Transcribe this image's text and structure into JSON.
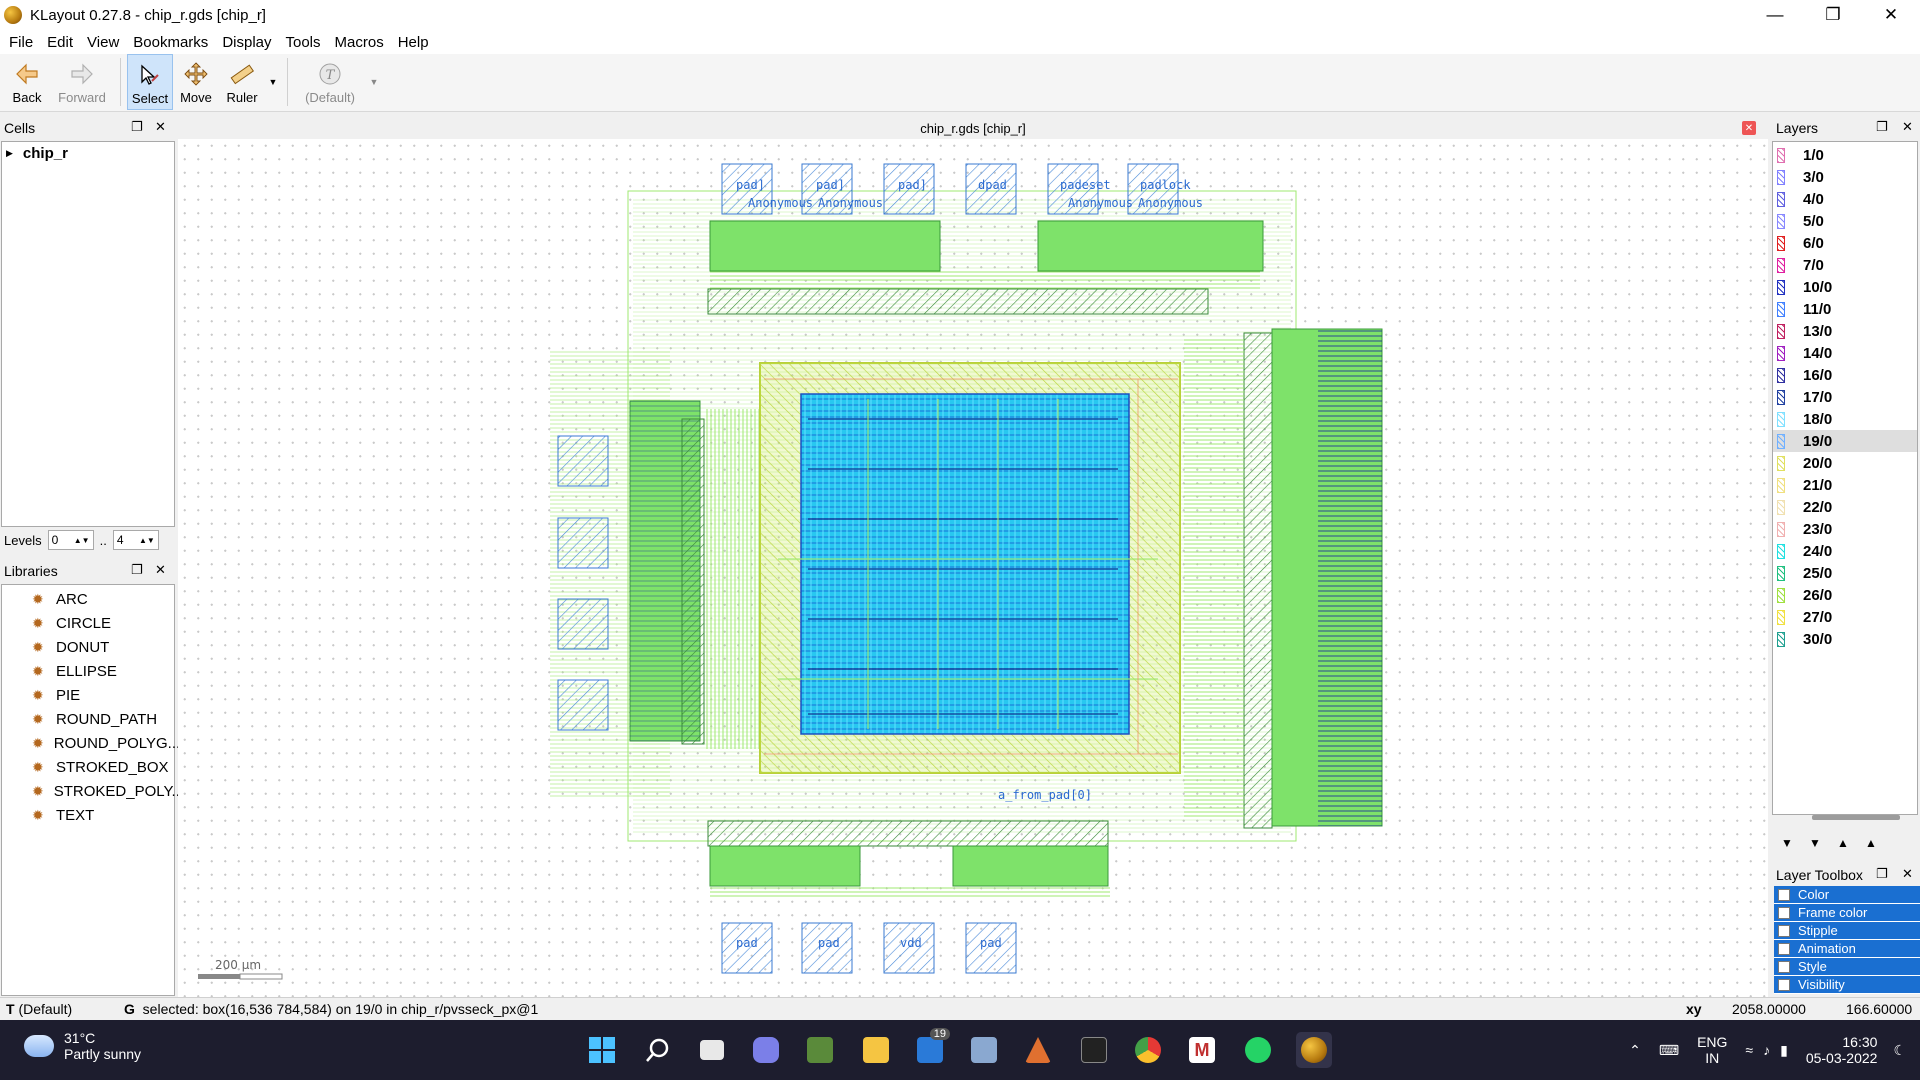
{
  "window": {
    "title": "KLayout 0.27.8 - chip_r.gds [chip_r]",
    "controls": [
      "minimize",
      "restore",
      "close"
    ]
  },
  "menu": [
    "File",
    "Edit",
    "View",
    "Bookmarks",
    "Display",
    "Tools",
    "Macros",
    "Help"
  ],
  "toolbar": {
    "back": "Back",
    "forward": "Forward",
    "select": "Select",
    "move": "Move",
    "ruler": "Ruler",
    "default_label": "(Default)"
  },
  "cells_panel": {
    "title": "Cells",
    "tree": [
      {
        "name": "chip_r",
        "expanded": false
      }
    ]
  },
  "levels": {
    "label": "Levels",
    "from": "0",
    "sep": "..",
    "to": "4"
  },
  "libraries_panel": {
    "title": "Libraries",
    "items": [
      "ARC",
      "CIRCLE",
      "DONUT",
      "ELLIPSE",
      "PIE",
      "ROUND_PATH",
      "ROUND_POLYG...",
      "STROKED_BOX",
      "STROKED_POLY...",
      "TEXT"
    ]
  },
  "canvas": {
    "title": "chip_r.gds [chip_r]",
    "scale_label": "200 µm",
    "labels_top": [
      "pad]",
      "pad]",
      "pad]",
      "dpad",
      "padeset",
      "padlock"
    ],
    "labels_sub": [
      "Anonymous",
      "Anonymous",
      "Anonymous",
      "Anonymous"
    ],
    "labels_bottom": [
      "a_from_pad[0]",
      "pad",
      "pad",
      "vdd",
      "pad"
    ]
  },
  "layers_panel": {
    "title": "Layers",
    "selected": "19/0",
    "items": [
      {
        "name": "1/0",
        "color": "#e070b0"
      },
      {
        "name": "3/0",
        "color": "#8080ff"
      },
      {
        "name": "4/0",
        "color": "#6060e0"
      },
      {
        "name": "5/0",
        "color": "#8888ff"
      },
      {
        "name": "6/0",
        "color": "#e02020"
      },
      {
        "name": "7/0",
        "color": "#e020a0"
      },
      {
        "name": "10/0",
        "color": "#2030c0"
      },
      {
        "name": "11/0",
        "color": "#4080ff"
      },
      {
        "name": "13/0",
        "color": "#c02060"
      },
      {
        "name": "14/0",
        "color": "#a020c0"
      },
      {
        "name": "16/0",
        "color": "#3030a0"
      },
      {
        "name": "17/0",
        "color": "#2040a0"
      },
      {
        "name": "18/0",
        "color": "#80e0ff"
      },
      {
        "name": "19/0",
        "color": "#70b0ff"
      },
      {
        "name": "20/0",
        "color": "#e0e060"
      },
      {
        "name": "21/0",
        "color": "#f0e080"
      },
      {
        "name": "22/0",
        "color": "#f0e0b0"
      },
      {
        "name": "23/0",
        "color": "#f0b0b0"
      },
      {
        "name": "24/0",
        "color": "#20e0e0"
      },
      {
        "name": "25/0",
        "color": "#20c080"
      },
      {
        "name": "26/0",
        "color": "#a0e040"
      },
      {
        "name": "27/0",
        "color": "#f0e040"
      },
      {
        "name": "30/0",
        "color": "#20a090"
      }
    ]
  },
  "layer_toolbox": {
    "title": "Layer Toolbox",
    "items": [
      "Color",
      "Frame color",
      "Stipple",
      "Animation",
      "Style",
      "Visibility"
    ]
  },
  "statusbar": {
    "mode": "T",
    "mode_value": "(Default)",
    "grid": "G",
    "message": "selected: box(16,536 784,584) on 19/0 in chip_r/pvsseck_px@1",
    "xy_label": "xy",
    "x": "2058.00000",
    "y": "166.60000"
  },
  "taskbar": {
    "weather_temp": "31°C",
    "weather_text": "Partly sunny",
    "mail_badge": "19",
    "lang1": "ENG",
    "lang2": "IN",
    "time": "16:30",
    "date": "05-03-2022"
  }
}
